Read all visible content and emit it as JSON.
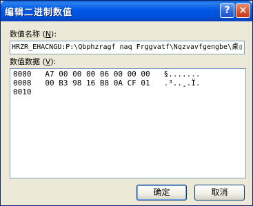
{
  "window": {
    "title": "编辑二进制数值",
    "help_glyph": "?",
    "close_glyph": "✕"
  },
  "value_name": {
    "label": "数值名称",
    "accel_open": " (",
    "accel_key": "N",
    "accel_close": "):",
    "value": "HRZR_EHACNGU:P:\\Qbphzragf naq Frggvatf\\Nqzvavfgengbe\\桌▯"
  },
  "value_data": {
    "label": "数值数据",
    "accel_open": " (",
    "accel_key": "V",
    "accel_close": "):",
    "lines": [
      "0000   A7 00 00 00 06 00 00 00   §.......",
      "0008   00 B3 98 16 B8 0A CF 01   .³..¸.Ï.",
      "0010"
    ]
  },
  "buttons": {
    "ok": "确定",
    "cancel": "取消"
  }
}
